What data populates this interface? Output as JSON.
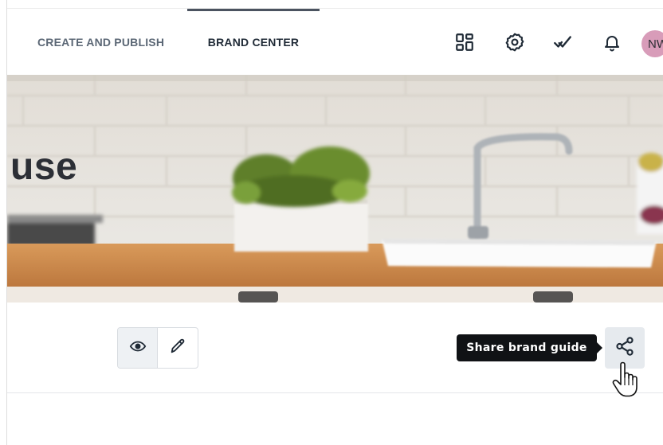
{
  "nav": {
    "tabs": [
      {
        "label": "CREATE AND PUBLISH",
        "active": false
      },
      {
        "label": "BRAND CENTER",
        "active": true
      }
    ]
  },
  "header": {
    "icons": [
      "dashboard-icon",
      "gear-icon",
      "double-check-icon",
      "bell-icon"
    ],
    "avatar_initials": "NW",
    "avatar_color": "#d89cb9"
  },
  "hero": {
    "title_fragment": "use"
  },
  "toolbar": {
    "view_icon": "eye-icon",
    "edit_icon": "pencil-icon",
    "share_icon": "share-icon",
    "tooltip": "Share brand guide"
  },
  "colors": {
    "active_tab_text": "#1f2a36",
    "inactive_tab_text": "#5b6775",
    "tooltip_bg": "#101215"
  }
}
